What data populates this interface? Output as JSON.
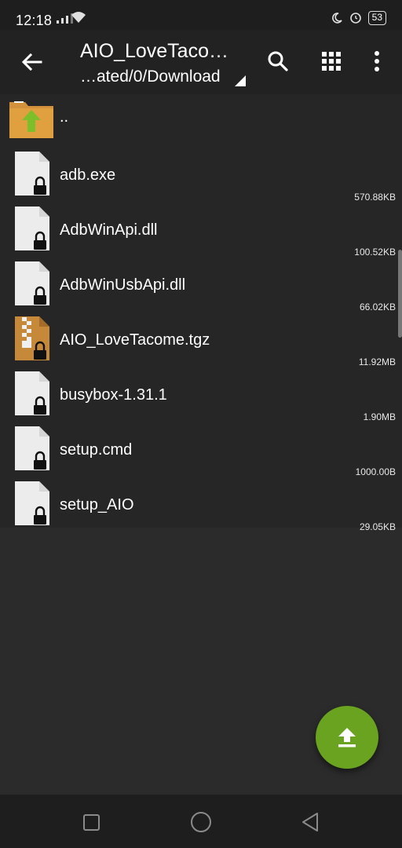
{
  "status": {
    "time": "12:18",
    "battery": "53"
  },
  "header": {
    "title": "AIO_LoveTaco…",
    "path": "…ated/0/Download",
    "icons": [
      "back-arrow-icon",
      "search-icon",
      "grid-view-icon",
      "more-vert-icon"
    ]
  },
  "files": [
    {
      "name": "..",
      "size": "",
      "type": "parent-folder"
    },
    {
      "name": "adb.exe",
      "size": "570.88KB",
      "type": "locked-file"
    },
    {
      "name": "AdbWinApi.dll",
      "size": "100.52KB",
      "type": "locked-file"
    },
    {
      "name": "AdbWinUsbApi.dll",
      "size": "66.02KB",
      "type": "locked-file"
    },
    {
      "name": "AIO_LoveTacome.tgz",
      "size": "11.92MB",
      "type": "archive-file"
    },
    {
      "name": "busybox-1.31.1",
      "size": "1.90MB",
      "type": "locked-file"
    },
    {
      "name": "setup.cmd",
      "size": "1000.00B",
      "type": "locked-file"
    },
    {
      "name": "setup_AIO",
      "size": "29.05KB",
      "type": "locked-file"
    }
  ],
  "fab": {
    "icon": "upload-icon"
  },
  "colors": {
    "accent": "#6aa320",
    "folder": "#e0a040",
    "background": "#2b2b2b"
  },
  "navbar": {
    "icons": [
      "recents-square-icon",
      "home-circle-icon",
      "back-triangle-icon"
    ]
  }
}
